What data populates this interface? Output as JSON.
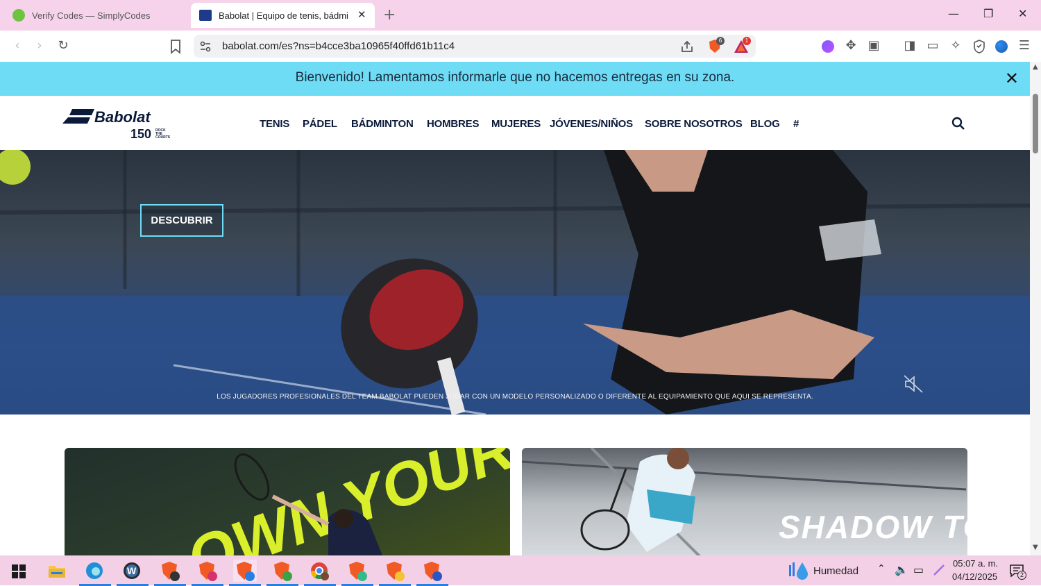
{
  "browser": {
    "tabs": [
      {
        "title": "Verify Codes — SimplyCodes",
        "active": false,
        "favicon": "simplycodes-icon"
      },
      {
        "title": "Babolat | Equipo de tenis, bádmi",
        "active": true,
        "favicon": "babolat-icon"
      }
    ],
    "url": "babolat.com/es?ns=b4cce3ba10965f40ffd61b11c4",
    "shield_count": "6",
    "rewards_count": "1"
  },
  "page": {
    "banner": {
      "text": "Bienvenido! Lamentamos informarle que no hacemos entregas en su zona.",
      "close_icon": "close-icon",
      "color": "#6fdcf6"
    },
    "nav": {
      "logo": "Babolat",
      "items": [
        "TENIS",
        "PÁDEL",
        "BÁDMINTON",
        "HOMBRES",
        "MUJERES",
        "JÓVENES/NIÑOS",
        "SOBRE NOSOTROS",
        "BLOG",
        "#"
      ]
    },
    "hero": {
      "cta": "DESCUBRIR",
      "disclaimer": "LOS JUGADORES PROFESIONALES DEL TEAM BABOLAT PUEDEN JUGAR CON UN MODELO PERSONALIZADO O DIFERENTE AL EQUIPAMIENTO QUE AQUI SE REPRESENTA."
    },
    "cards": [
      {
        "name": "tennis-promo",
        "text": "OWN YOUR"
      },
      {
        "name": "badminton-promo",
        "text": "SHADOW TOUR"
      }
    ]
  },
  "taskbar": {
    "weather": "Humedad",
    "time": "05:07 a. m.",
    "date": "04/12/2025",
    "notifications": "2"
  }
}
